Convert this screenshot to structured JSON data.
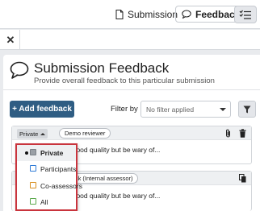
{
  "nav": {
    "submission_label": "Submission",
    "feedback_label": "Feedback"
  },
  "panel": {
    "title": "Submission Feedback",
    "subtitle": "Provide overall feedback to this particular submission"
  },
  "toolbar": {
    "add_label": "+ Add feedback",
    "filter_label": "Filter by",
    "filter_placeholder": "No filter applied"
  },
  "card1": {
    "visibility": "Private",
    "reviewer": "Demo reviewer",
    "text": "f good quality but be wary of..."
  },
  "card2": {
    "reviewer": "lock (Internal assessor)",
    "text": "f good quality but be wary of..."
  },
  "visibility_menu": {
    "options": [
      {
        "label": "Private",
        "selected": true,
        "color": "#9aa0a6"
      },
      {
        "label": "Participants",
        "selected": false,
        "color": "#2f7bd6"
      },
      {
        "label": "Co-assessors",
        "selected": false,
        "color": "#d99020"
      },
      {
        "label": "All",
        "selected": false,
        "color": "#58a84a"
      }
    ]
  },
  "colors": {
    "primary": "#2f5d83",
    "highlight_border": "#c9343d"
  },
  "icons": [
    "document-icon",
    "chat-icon",
    "checklist-icon",
    "close-icon",
    "speech-bubble-icon",
    "filter-icon",
    "paperclip-icon",
    "trash-icon",
    "copy-icon"
  ]
}
